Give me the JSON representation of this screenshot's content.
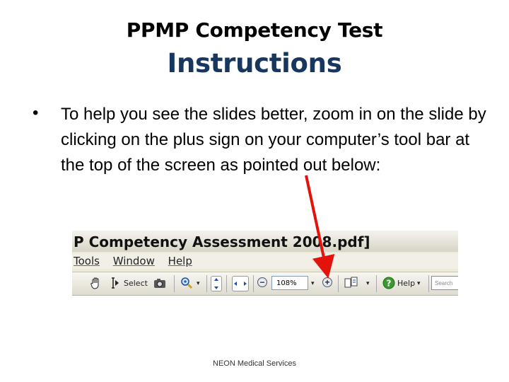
{
  "slide": {
    "title_top": "PPMP Competency Test",
    "title_main": "Instructions",
    "bullet_symbol": "•",
    "body": "To help you see the slides better, zoom in on the slide by clicking on the plus sign on your computer’s tool bar at the top of the screen as pointed out below:",
    "footer": "NEON Medical Services",
    "colors": {
      "title_main": "#17375e",
      "arrow": "#e3120b"
    }
  },
  "screenshot": {
    "window_title": "P Competency Assessment 2008.pdf]",
    "menu": [
      "Tools",
      "Window",
      "Help"
    ],
    "toolbar": {
      "hand_icon": "hand-icon",
      "select_label": "Select",
      "snapshot_icon": "camera-icon",
      "zoom_icon": "magnifier-icon",
      "fit_page_icon": "fit-page-icon",
      "fit_width_icon": "fit-width-icon",
      "zoom_out_symbol": "−",
      "zoom_value": "108%",
      "zoom_in_symbol": "+",
      "pages_icon": "pages-icon",
      "help_label": "Help",
      "search_placeholder": "Search"
    }
  }
}
